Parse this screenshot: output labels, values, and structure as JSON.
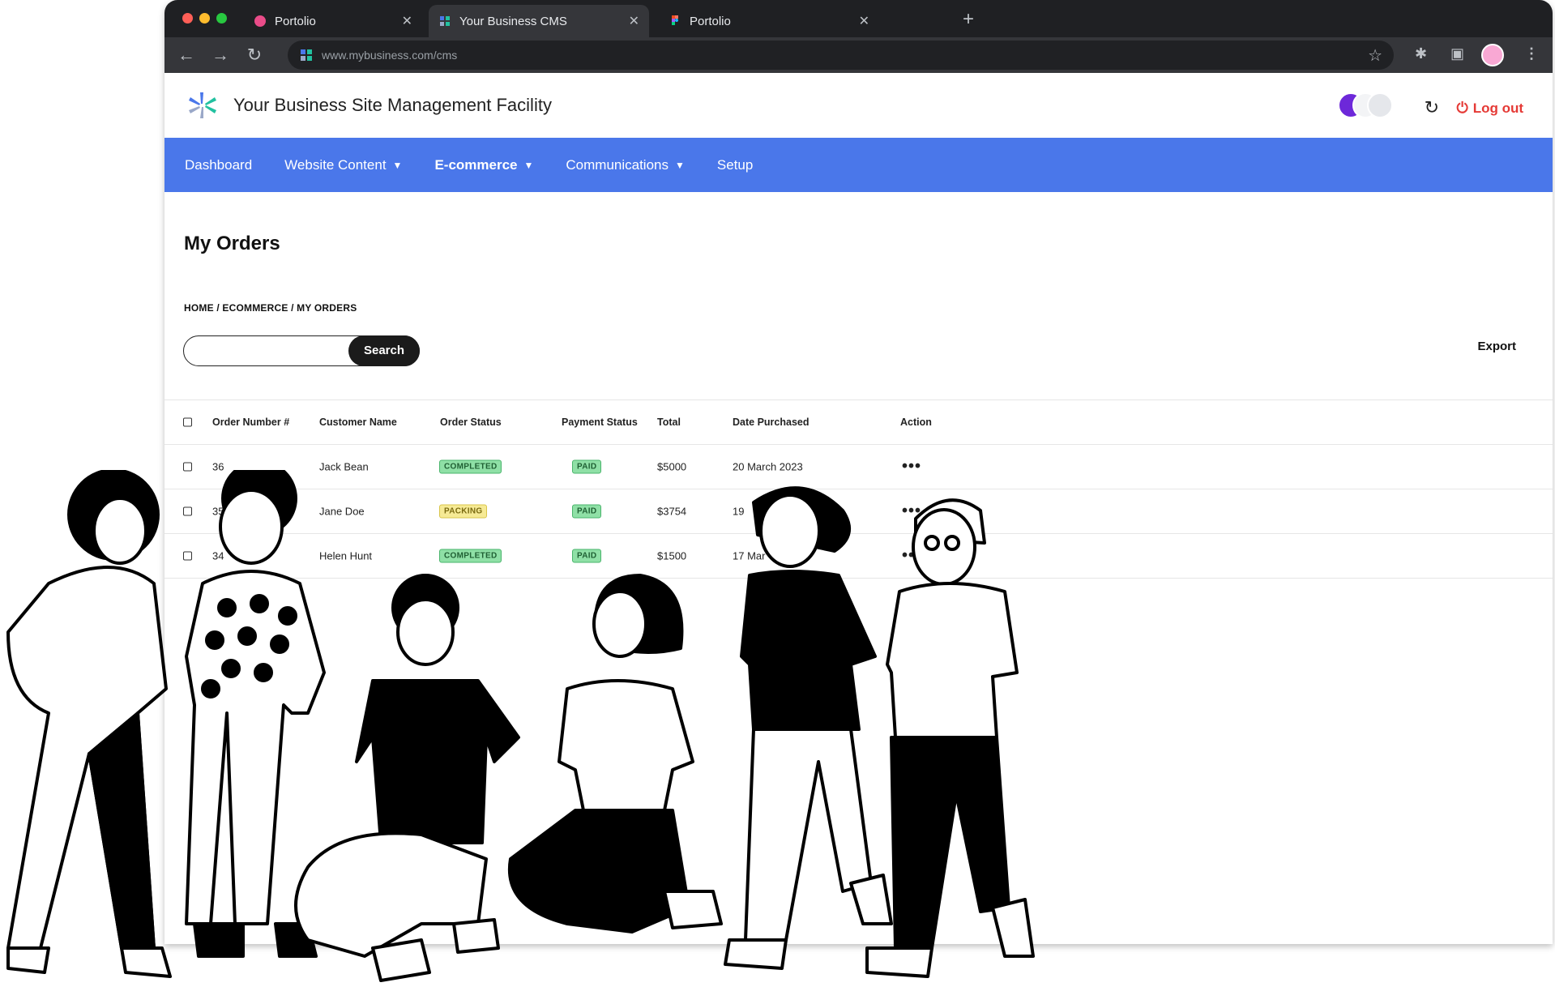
{
  "browser": {
    "tabs": [
      {
        "label": "Portolio",
        "icon": "dribbble-icon"
      },
      {
        "label": "Your Business CMS",
        "icon": "cms-logo-icon",
        "active": true
      },
      {
        "label": "Portolio",
        "icon": "figma-icon"
      }
    ],
    "url": "www.mybusiness.com/cms"
  },
  "header": {
    "title": "Your Business Site Management Facility",
    "logout_label": "Log out"
  },
  "nav": {
    "items": [
      {
        "label": "Dashboard"
      },
      {
        "label": "Website Content"
      },
      {
        "label": "E-commerce"
      },
      {
        "label": "Communications"
      },
      {
        "label": "Setup"
      }
    ]
  },
  "page": {
    "title": "My Orders",
    "breadcrumb": "HOME / ECOMMERCE / MY ORDERS",
    "search_button": "Search",
    "search_value": "",
    "export_label": "Export"
  },
  "table": {
    "columns": [
      "Order Number #",
      "Customer Name",
      "Order Status",
      "Payment Status",
      "Total",
      "Date Purchased",
      "Action"
    ],
    "rows": [
      {
        "order": "36",
        "customer": "Jack Bean",
        "status": "COMPLETED",
        "payment": "PAID",
        "total": "$5000",
        "date": "20 March 2023",
        "action": "•••"
      },
      {
        "order": "35",
        "customer": "Jane Doe",
        "status": "PACKING",
        "payment": "PAID",
        "total": "$3754",
        "date": "19",
        "action": "•••"
      },
      {
        "order": "34",
        "customer": "Helen Hunt",
        "status": "COMPLETED",
        "payment": "PAID",
        "total": "$1500",
        "date": "17 Mar",
        "action": "•••"
      }
    ]
  },
  "colors": {
    "nav_bg": "#4a77ea",
    "logout": "#e53935",
    "completed": "#8fe0a6",
    "packing": "#f6ea95"
  }
}
